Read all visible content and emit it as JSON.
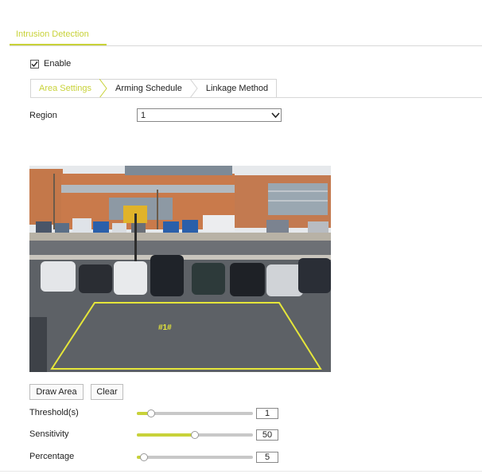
{
  "header": {
    "title": "Intrusion Detection"
  },
  "enable": {
    "label": "Enable",
    "checked": true
  },
  "tabs": [
    {
      "label": "Area Settings",
      "active": true
    },
    {
      "label": "Arming Schedule",
      "active": false
    },
    {
      "label": "Linkage Method",
      "active": false
    }
  ],
  "region": {
    "label": "Region",
    "value": "1"
  },
  "preview": {
    "zone_label": "#1#"
  },
  "buttons": {
    "draw": "Draw Area",
    "clear": "Clear"
  },
  "sliders": [
    {
      "label": "Threshold(s)",
      "value": "1",
      "fraction": 0.12
    },
    {
      "label": "Sensitivity",
      "value": "50",
      "fraction": 0.5
    },
    {
      "label": "Percentage",
      "value": "5",
      "fraction": 0.06
    }
  ],
  "colors": {
    "accent": "#c8d239",
    "zone": "#e5e63a"
  }
}
